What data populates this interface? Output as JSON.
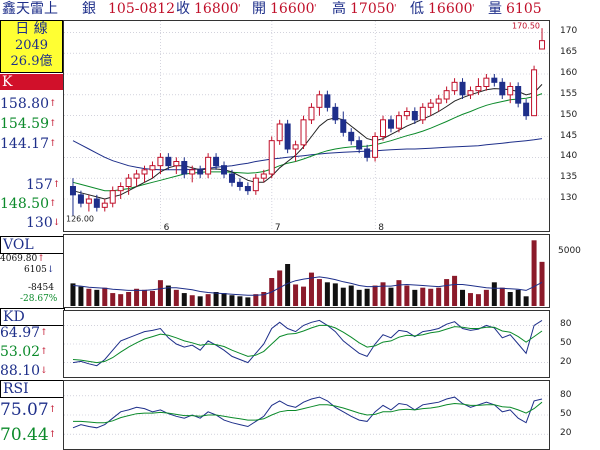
{
  "header": {
    "name": "鑫天雷上",
    "suffix": "銀",
    "date_code": "105-0812",
    "close_label": "收",
    "close_value": "16800",
    "open_label": "開",
    "open_value": "16600",
    "high_label": "高",
    "high_value": "17050",
    "low_label": "低",
    "low_value": "16600",
    "volume_label": "量",
    "volume_value": "6105",
    "mark": "'"
  },
  "sidebar": {
    "period_label": "日 線",
    "count": "2049",
    "amount": "26.9億",
    "kline_tab": "K",
    "ma_values": [
      "158.80",
      "154.59",
      "144.17"
    ],
    "lower_values": [
      "157",
      "148.50",
      "130"
    ],
    "vol_tab": "VOL",
    "vol_values": [
      "4069.80",
      "6105"
    ],
    "vol_diff": [
      "-8454",
      "-28.67%"
    ],
    "kd_tab": "KD",
    "kd_values": [
      "64.97",
      "53.02",
      "88.10"
    ],
    "rsi_tab": "RSI",
    "rsi_values": [
      "75.07",
      "70.44"
    ]
  },
  "colors": {
    "up": "#c0102a",
    "down": "#1e2f8a",
    "ma_green": "#0b8a2a",
    "ma_blue": "#1e2f8a",
    "grid": "#8080a0"
  },
  "main_chart": {
    "y_ticks": [
      "170",
      "165",
      "160",
      "155",
      "150",
      "145",
      "140",
      "135",
      "130"
    ],
    "months": [
      "6",
      "7",
      "8"
    ],
    "annot_high": "170.50",
    "annot_low": "126.00"
  },
  "volume_chart": {
    "y_ticks": [
      "5000"
    ]
  },
  "kd_chart": {
    "y_ticks": [
      "80",
      "50",
      "20"
    ]
  },
  "rsi_chart": {
    "y_ticks": [
      "80",
      "50",
      "20"
    ]
  },
  "chart_data": [
    {
      "type": "candlestick",
      "title": "",
      "ylim": [
        124,
        172
      ],
      "candles": [
        [
          133,
          135,
          126,
          131
        ],
        [
          131,
          132,
          128,
          129
        ],
        [
          129,
          131,
          127,
          130
        ],
        [
          130,
          131,
          127,
          128
        ],
        [
          128,
          130,
          127,
          129
        ],
        [
          129,
          133,
          128,
          132
        ],
        [
          132,
          134,
          130,
          133
        ],
        [
          133,
          136,
          131,
          135
        ],
        [
          135,
          137,
          133,
          136
        ],
        [
          136,
          138,
          134,
          137
        ],
        [
          137,
          139,
          135,
          138
        ],
        [
          138,
          141,
          136,
          140
        ],
        [
          140,
          141,
          137,
          138
        ],
        [
          138,
          140,
          136,
          139
        ],
        [
          139,
          140,
          135,
          136
        ],
        [
          136,
          138,
          134,
          137
        ],
        [
          137,
          138,
          135,
          136
        ],
        [
          136,
          141,
          135,
          140
        ],
        [
          140,
          141,
          137,
          138
        ],
        [
          138,
          139,
          135,
          136
        ],
        [
          136,
          137,
          133,
          134
        ],
        [
          134,
          135,
          132,
          133
        ],
        [
          133,
          134,
          131,
          132
        ],
        [
          132,
          136,
          131,
          135
        ],
        [
          135,
          137,
          134,
          136
        ],
        [
          136,
          145,
          135,
          144
        ],
        [
          144,
          149,
          143,
          148
        ],
        [
          148,
          149,
          141,
          142
        ],
        [
          142,
          144,
          139,
          143
        ],
        [
          143,
          150,
          142,
          149
        ],
        [
          149,
          153,
          148,
          152
        ],
        [
          152,
          156,
          150,
          155
        ],
        [
          155,
          156,
          151,
          152
        ],
        [
          152,
          153,
          148,
          149
        ],
        [
          149,
          151,
          145,
          146
        ],
        [
          146,
          147,
          143,
          144
        ],
        [
          144,
          145,
          141,
          142
        ],
        [
          142,
          143,
          139,
          140
        ],
        [
          140,
          146,
          139,
          145
        ],
        [
          145,
          150,
          144,
          149
        ],
        [
          149,
          150,
          146,
          147
        ],
        [
          147,
          151,
          146,
          150
        ],
        [
          150,
          152,
          149,
          151
        ],
        [
          151,
          152,
          148,
          149
        ],
        [
          149,
          153,
          148,
          152
        ],
        [
          152,
          154,
          150,
          153
        ],
        [
          153,
          155,
          151,
          154
        ],
        [
          154,
          157,
          153,
          156
        ],
        [
          156,
          159,
          155,
          158
        ],
        [
          158,
          159,
          154,
          155
        ],
        [
          155,
          157,
          154,
          156
        ],
        [
          156,
          159,
          155,
          157
        ],
        [
          157,
          160,
          156,
          159
        ],
        [
          159,
          160,
          157,
          158
        ],
        [
          158,
          159,
          154,
          155
        ],
        [
          155,
          158,
          153,
          157
        ],
        [
          157,
          158,
          152,
          153
        ],
        [
          153,
          154,
          149,
          150
        ],
        [
          150,
          162,
          150,
          161
        ],
        [
          166,
          171,
          166,
          168
        ]
      ],
      "ma_green": [
        134,
        133.5,
        133,
        132.5,
        132,
        132,
        132.2,
        132.5,
        133,
        133.5,
        134,
        134.5,
        135,
        135.5,
        136,
        136.2,
        136.4,
        136.5,
        136.5,
        136.5,
        136.4,
        136.3,
        136.2,
        136.3,
        136.6,
        137.2,
        138,
        138.6,
        139,
        139.6,
        140.3,
        141,
        141.6,
        142,
        142.3,
        142.5,
        142.6,
        142.7,
        143,
        143.5,
        144,
        144.6,
        145.2,
        145.7,
        146.3,
        147,
        147.8,
        148.6,
        149.5,
        150.3,
        151,
        151.8,
        152.5,
        153,
        153.4,
        153.8,
        154,
        154.2,
        154.6,
        155.3
      ],
      "ma_blue": [
        144,
        143,
        142,
        141,
        140,
        139.2,
        138.6,
        138,
        137.6,
        137.3,
        137.1,
        137,
        137,
        137,
        137,
        137.1,
        137.2,
        137.4,
        137.6,
        137.8,
        138,
        138.3,
        138.6,
        139,
        139.3,
        139.6,
        139.8,
        140,
        140.2,
        140.4,
        140.6,
        140.8,
        141,
        141.1,
        141.2,
        141.3,
        141.4,
        141.5,
        141.6,
        141.7,
        141.8,
        141.9,
        142,
        142,
        142.1,
        142.2,
        142.3,
        142.4,
        142.5,
        142.6,
        142.7,
        142.8,
        143,
        143.2,
        143.4,
        143.6,
        143.8,
        144,
        144.2,
        144.5
      ],
      "ma_dark": [
        132,
        131.5,
        131,
        130.5,
        130,
        130.5,
        131,
        132,
        133,
        134,
        135,
        136.5,
        137.5,
        138,
        138,
        137.5,
        137,
        137.2,
        137.2,
        137,
        136.5,
        135.5,
        134.5,
        134,
        134,
        135.5,
        137.5,
        139,
        140.5,
        142.5,
        145,
        147.5,
        149,
        149.5,
        149,
        147.5,
        146,
        144.5,
        144,
        144.5,
        145.5,
        146.5,
        147.5,
        148.3,
        149.2,
        150,
        151,
        152.2,
        153.5,
        154.3,
        155,
        155.6,
        156.2,
        156.5,
        156.4,
        156.2,
        155.8,
        155,
        155.5,
        157.5
      ]
    },
    {
      "type": "bar",
      "title": "",
      "ylabel": "VOL",
      "ylim": [
        0,
        6500
      ],
      "values": [
        2100,
        1800,
        1600,
        1500,
        1700,
        1200,
        1100,
        1300,
        1600,
        1500,
        1400,
        2400,
        1900,
        1500,
        1200,
        1000,
        900,
        1100,
        1300,
        1200,
        1000,
        900,
        800,
        1100,
        1300,
        2600,
        3300,
        3900,
        2000,
        1800,
        3100,
        2500,
        2200,
        2100,
        1700,
        1900,
        1500,
        1600,
        1900,
        2200,
        1700,
        2400,
        1900,
        1500,
        1700,
        1600,
        1700,
        2500,
        2800,
        1500,
        1200,
        1100,
        1500,
        2200,
        1700,
        1300,
        1500,
        900,
        6100,
        4100
      ],
      "up": [
        false,
        false,
        true,
        false,
        true,
        true,
        true,
        true,
        true,
        true,
        true,
        true,
        false,
        true,
        false,
        true,
        false,
        true,
        false,
        false,
        false,
        false,
        false,
        true,
        true,
        true,
        true,
        false,
        true,
        true,
        true,
        true,
        false,
        false,
        false,
        false,
        false,
        false,
        true,
        true,
        false,
        true,
        true,
        false,
        true,
        true,
        true,
        true,
        true,
        false,
        true,
        true,
        true,
        false,
        true,
        false,
        false,
        false,
        true,
        true
      ],
      "ma": [
        1900,
        1850,
        1750,
        1700,
        1650,
        1550,
        1500,
        1450,
        1450,
        1450,
        1500,
        1600,
        1700,
        1700,
        1600,
        1500,
        1350,
        1250,
        1200,
        1150,
        1100,
        1050,
        1000,
        1000,
        1050,
        1300,
        1700,
        2100,
        2350,
        2500,
        2600,
        2700,
        2600,
        2450,
        2250,
        2100,
        1900,
        1800,
        1800,
        1850,
        1850,
        1950,
        2000,
        1950,
        1900,
        1850,
        1800,
        1900,
        2000,
        2000,
        1900,
        1800,
        1700,
        1650,
        1650,
        1600,
        1550,
        1450,
        1800,
        2200
      ]
    },
    {
      "type": "line",
      "title": "",
      "ylabel": "KD",
      "ylim": [
        0,
        100
      ],
      "series": [
        {
          "values": [
            20,
            22,
            18,
            15,
            25,
            40,
            55,
            60,
            65,
            70,
            72,
            75,
            60,
            50,
            45,
            48,
            40,
            55,
            48,
            40,
            30,
            25,
            20,
            35,
            50,
            75,
            85,
            75,
            70,
            80,
            85,
            88,
            80,
            70,
            55,
            45,
            35,
            30,
            50,
            65,
            60,
            72,
            70,
            62,
            70,
            72,
            75,
            82,
            86,
            75,
            72,
            74,
            80,
            76,
            60,
            65,
            50,
            35,
            80,
            88
          ]
        },
        {
          "values": [
            25,
            24,
            22,
            20,
            22,
            28,
            37,
            45,
            52,
            58,
            62,
            66,
            64,
            60,
            55,
            52,
            48,
            50,
            49,
            46,
            40,
            35,
            30,
            32,
            38,
            50,
            62,
            66,
            67,
            71,
            76,
            80,
            80,
            76,
            69,
            61,
            52,
            45,
            47,
            53,
            55,
            61,
            64,
            63,
            65,
            68,
            70,
            74,
            78,
            77,
            75,
            75,
            77,
            77,
            71,
            69,
            62,
            53,
            62,
            71
          ]
        }
      ]
    },
    {
      "type": "line",
      "title": "",
      "ylabel": "RSI",
      "ylim": [
        0,
        100
      ],
      "series": [
        {
          "values": [
            30,
            35,
            32,
            30,
            35,
            45,
            55,
            58,
            62,
            60,
            55,
            58,
            52,
            48,
            45,
            50,
            45,
            55,
            50,
            42,
            38,
            35,
            32,
            40,
            48,
            65,
            72,
            65,
            62,
            70,
            75,
            78,
            72,
            62,
            55,
            48,
            42,
            40,
            55,
            65,
            58,
            68,
            66,
            58,
            66,
            68,
            70,
            75,
            78,
            68,
            62,
            66,
            70,
            66,
            55,
            58,
            45,
            38,
            72,
            75
          ]
        },
        {
          "values": [
            40,
            40,
            39,
            38,
            38,
            41,
            46,
            49,
            52,
            53,
            53,
            54,
            53,
            51,
            49,
            49,
            48,
            50,
            50,
            48,
            46,
            44,
            42,
            42,
            44,
            50,
            55,
            57,
            57,
            60,
            63,
            66,
            66,
            64,
            61,
            57,
            53,
            50,
            51,
            55,
            55,
            58,
            59,
            58,
            60,
            61,
            63,
            66,
            68,
            67,
            65,
            65,
            66,
            66,
            63,
            62,
            58,
            53,
            60,
            70
          ]
        }
      ]
    }
  ]
}
